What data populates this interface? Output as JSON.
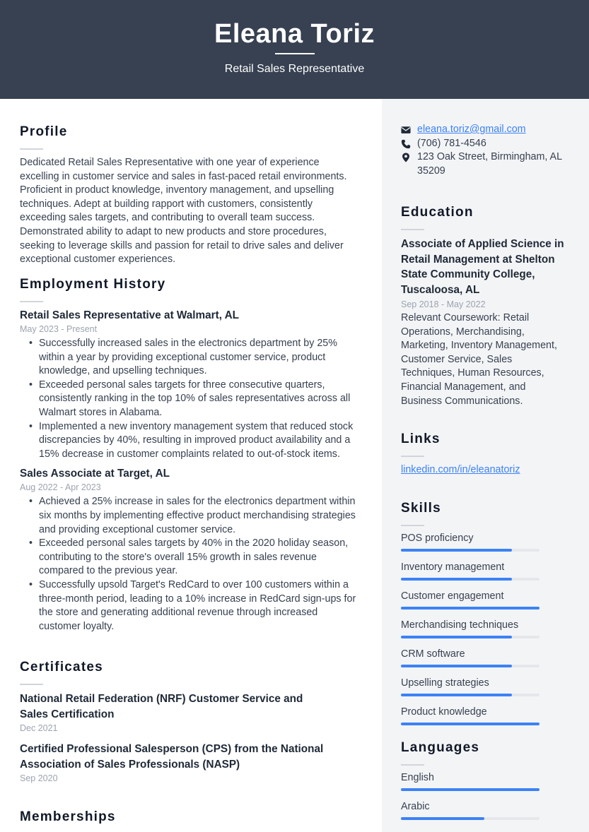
{
  "header": {
    "name": "Eleana Toriz",
    "title": "Retail Sales Representative",
    "background": "#374151"
  },
  "profile": {
    "heading": "Profile",
    "text": "Dedicated Retail Sales Representative with one year of experience excelling in customer service and sales in fast-paced retail environments. Proficient in product knowledge, inventory management, and upselling techniques. Adept at building rapport with customers, consistently exceeding sales targets, and contributing to overall team success. Demonstrated ability to adapt to new products and store procedures, seeking to leverage skills and passion for retail to drive sales and deliver exceptional customer experiences."
  },
  "employment": {
    "heading": "Employment History",
    "jobs": [
      {
        "title": "Retail Sales Representative at Walmart, AL",
        "dates": "May 2023 - Present",
        "bullets": [
          "Successfully increased sales in the electronics department by 25% within a year by providing exceptional customer service, product knowledge, and upselling techniques.",
          "Exceeded personal sales targets for three consecutive quarters, consistently ranking in the top 10% of sales representatives across all Walmart stores in Alabama.",
          "Implemented a new inventory management system that reduced stock discrepancies by 40%, resulting in improved product availability and a 15% decrease in customer complaints related to out-of-stock items."
        ]
      },
      {
        "title": "Sales Associate at Target, AL",
        "dates": "Aug 2022 - Apr 2023",
        "bullets": [
          "Achieved a 25% increase in sales for the electronics department within six months by implementing effective product merchandising strategies and providing exceptional customer service.",
          "Exceeded personal sales targets by 40% in the 2020 holiday season, contributing to the store's overall 15% growth in sales revenue compared to the previous year.",
          "Successfully upsold Target's RedCard to over 100 customers within a three-month period, leading to a 10% increase in RedCard sign-ups for the store and generating additional revenue through increased customer loyalty."
        ]
      }
    ]
  },
  "certificates": {
    "heading": "Certificates",
    "items": [
      {
        "title": "National Retail Federation (NRF) Customer Service and Sales Certification",
        "date": "Dec 2021"
      },
      {
        "title": "Certified Professional Salesperson (CPS) from the National Association of Sales Professionals (NASP)",
        "date": "Sep 2020"
      }
    ]
  },
  "memberships": {
    "heading": "Memberships"
  },
  "contact": {
    "email": "eleana.toriz@gmail.com",
    "phone": "(706) 781-4546",
    "address": "123 Oak Street, Birmingham, AL 35209",
    "icons": {
      "email": "envelope-icon",
      "phone": "phone-icon",
      "address": "map-pin-icon"
    }
  },
  "education": {
    "heading": "Education",
    "degree": "Associate of Applied Science in Retail Management at Shelton State Community College, Tuscaloosa, AL",
    "dates": "Sep 2018 - May 2022",
    "description": "Relevant Coursework: Retail Operations, Merchandising, Marketing, Inventory Management, Customer Service, Sales Techniques, Human Resources, Financial Management, and Business Communications."
  },
  "links": {
    "heading": "Links",
    "items": [
      "linkedin.com/in/eleanatoriz"
    ]
  },
  "skills": {
    "heading": "Skills",
    "items": [
      {
        "name": "POS proficiency",
        "level": 0.8
      },
      {
        "name": "Inventory management",
        "level": 0.8
      },
      {
        "name": "Customer engagement",
        "level": 1.0
      },
      {
        "name": "Merchandising techniques",
        "level": 0.8
      },
      {
        "name": "CRM software",
        "level": 0.8
      },
      {
        "name": "Upselling strategies",
        "level": 0.8
      },
      {
        "name": "Product knowledge",
        "level": 1.0
      }
    ]
  },
  "languages": {
    "heading": "Languages",
    "items": [
      {
        "name": "English",
        "level": 1.0
      },
      {
        "name": "Arabic",
        "level": 0.6
      }
    ]
  },
  "colors": {
    "accent": "#3b82f6",
    "sidebar": "#f3f4f6",
    "header": "#374151"
  }
}
